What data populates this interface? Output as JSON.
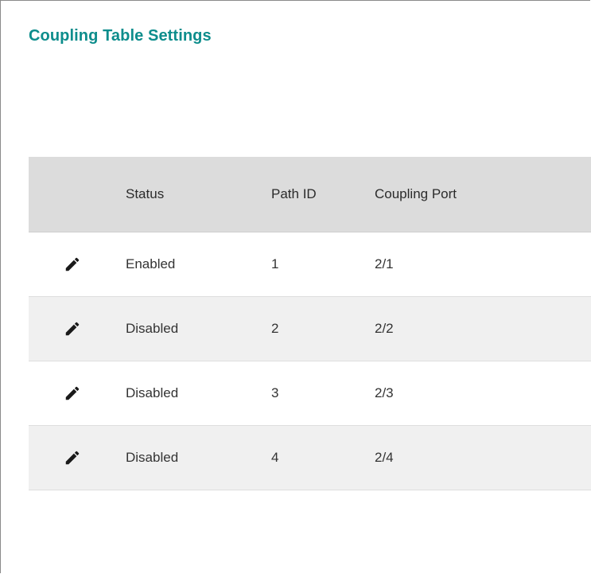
{
  "title": "Coupling Table Settings",
  "table": {
    "columns": {
      "status": "Status",
      "path_id": "Path ID",
      "coupling_port": "Coupling Port"
    },
    "rows": [
      {
        "status": "Enabled",
        "path_id": "1",
        "coupling_port": "2/1"
      },
      {
        "status": "Disabled",
        "path_id": "2",
        "coupling_port": "2/2"
      },
      {
        "status": "Disabled",
        "path_id": "3",
        "coupling_port": "2/3"
      },
      {
        "status": "Disabled",
        "path_id": "4",
        "coupling_port": "2/4"
      }
    ],
    "row_action_icon": "pencil-icon"
  },
  "colors": {
    "title": "#0d8d8c",
    "header_bg": "#dcdcdc",
    "alt_row_bg": "#f0f0f0",
    "icon": "#1a1a1a"
  }
}
